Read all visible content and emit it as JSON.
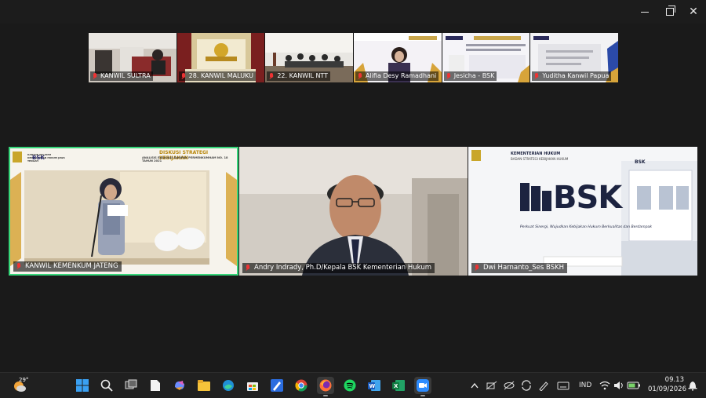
{
  "window": {
    "minimize_label": "Minimize",
    "maximize_label": "Maximize",
    "close_label": "Close"
  },
  "strip": [
    {
      "name": "KANWIL SULTRA"
    },
    {
      "name": "28. KANWIL MALUKU"
    },
    {
      "name": "22. KANWIL NTT"
    },
    {
      "name": "Alifia Desy Ramadhani"
    },
    {
      "name": "Jesicha - BSK"
    },
    {
      "name": "Yuditha Kanwil Papua"
    }
  ],
  "tiles": [
    {
      "name": "KANWIL KEMENKUM JATENG",
      "slide_org": "KANTOR WILAYAH KEMENTERIAN HUKUM JAWA TENGAH",
      "slide_logo": "BSK",
      "slide_title": "DISKUSI STRATEGI KEBIJAKAN",
      "slide_subtitle": "ANALISIS EVALUASI DAMPAK PERMENKUMHAM NO. 18 TAHUN 2021"
    },
    {
      "name": "Andry Indrady, Ph.D/Kepala BSK Kementerian Hukum"
    },
    {
      "name": "Dwi Harnanto_Ses BSKH",
      "slide_org_line1": "KEMENTERIAN HUKUM",
      "slide_org_line2": "BADAN STRATEGI KEBIJAKAN HUKUM",
      "slide_brand": "BSK",
      "slide_tagline": "Perkuat Sinergi, Wujudkan Kebijakan Hukum Berkualitas dan Berdampak",
      "slide_side_logo": "BSK"
    }
  ],
  "taskbar": {
    "weather_temp": "29°",
    "language": "IND",
    "time": "09.13",
    "date": "01/09/2026"
  },
  "colors": {
    "active_speaker_border": "#36d67a",
    "muted_mic": "#e33333"
  }
}
